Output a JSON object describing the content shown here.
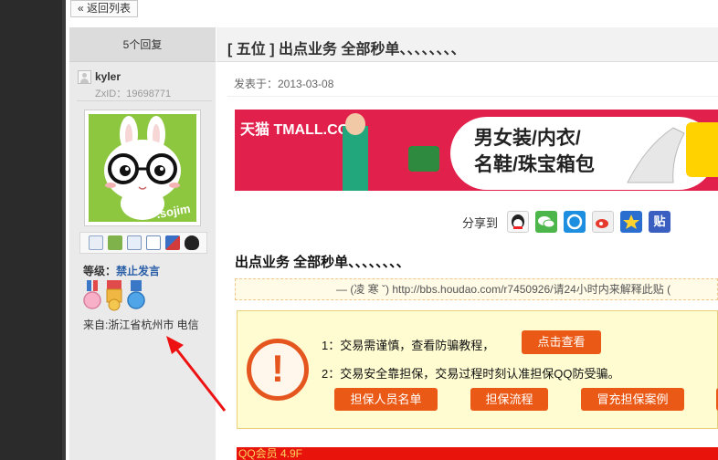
{
  "nav": {
    "back_label": "« 返回列表"
  },
  "sidebar": {
    "reply_count": "5个回复",
    "username": "kyler",
    "zxid": "ZxID：19698771",
    "level_label": "等级：",
    "level_value": "禁止发言",
    "location": "来自:浙江省杭州市 电信",
    "avatar_caption": ".sojim",
    "action_icons": [
      "mail-icon",
      "add-friend-icon",
      "profile-icon",
      "message-icon",
      "share-icon",
      "qq-icon"
    ],
    "medal_icons": [
      "medal-pink-icon",
      "medal-gold-icon",
      "medal-blue-icon"
    ]
  },
  "post": {
    "title": "[ 五位 ] 出点业务 全部秒单、、、、、、、、",
    "posted_at": "发表于：2013-03-08",
    "banner": {
      "brand": "天猫 TMALL.COM",
      "line1": "男女装/内衣/",
      "line2": "名鞋/珠宝箱包"
    },
    "share_label": "分享到",
    "share_icons": [
      "qq-icon",
      "wechat-icon",
      "qzone-icon",
      "weibo-icon",
      "favorite-icon",
      "tieba-icon"
    ],
    "body_title": "出点业务 全部秒单、、、、、、、、",
    "quote_text": "— (凌 寒 ˇ) http://bbs.houdao.com/r7450926/请24小时内来解释此贴 (",
    "notice": {
      "line1": "1：交易需谨慎，查看防骗教程，",
      "line2": "2：交易安全靠担保，交易过程时刻认准担保QQ防受骗。",
      "view_button": "点击查看",
      "buttons": [
        "担保人员名单",
        "担保流程",
        "冒充担保案例"
      ]
    },
    "footer_text": "QQ会员 4.9F"
  },
  "colors": {
    "accent_orange": "#ea5a16",
    "banner_red": "#e1204b",
    "level_blue": "#2b5fa8"
  }
}
